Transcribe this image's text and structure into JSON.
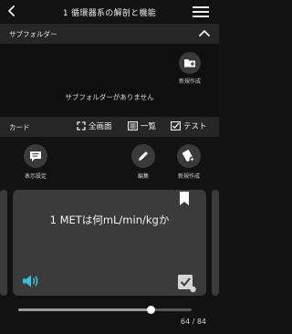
{
  "header": {
    "title": "1 循環器系の解剖と機能"
  },
  "subfolder": {
    "label": "サブフォルダー",
    "new_label": "新規作成",
    "empty_message": "サブフォルダーがありません"
  },
  "card_bar": {
    "label": "カード",
    "fullscreen": "全画面",
    "list": "一覧",
    "test": "テスト"
  },
  "actions": {
    "display_settings": "表示設定",
    "edit": "編集",
    "new": "新規作成"
  },
  "card": {
    "question": "1 METは何mL/min/kgか"
  },
  "progress": {
    "current": 64,
    "total": 84,
    "counter_text": "64 / 84"
  },
  "icons": {
    "back": "chevron-left-icon",
    "menu": "hamburger-icon",
    "collapse": "chevron-up-icon",
    "new_folder": "folder-plus-icon",
    "fullscreen": "expand-icon",
    "list": "list-icon",
    "test": "checkbox-icon",
    "display_settings": "chat-lines-icon",
    "edit": "pencil-icon",
    "new_card": "card-plus-icon",
    "bookmark": "bookmark-icon",
    "speaker": "speaker-icon",
    "check": "check-icon"
  },
  "colors": {
    "background": "#121212",
    "bar": "#262626",
    "card": "#3b3b3b",
    "speaker": "#3cc0d6"
  }
}
